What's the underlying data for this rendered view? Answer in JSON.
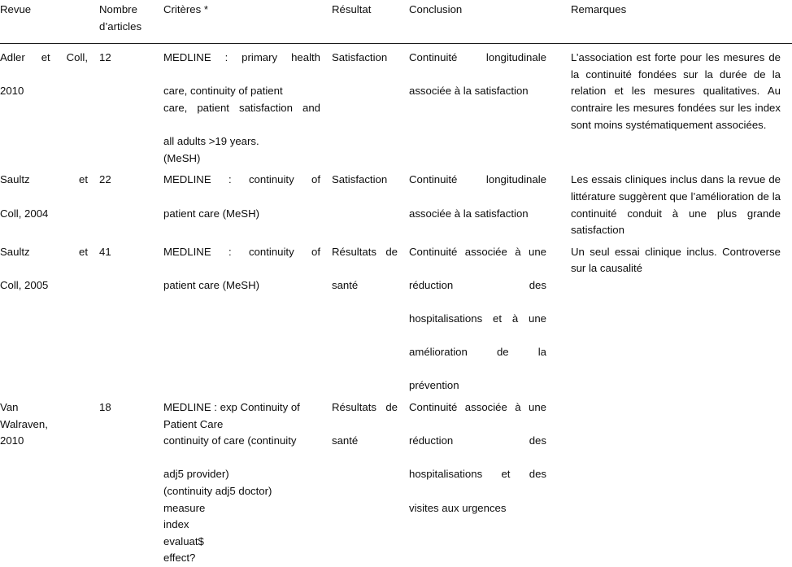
{
  "table": {
    "caption_note": "Critères *",
    "columns": [
      {
        "key": "revue",
        "label": "Revue"
      },
      {
        "key": "nombre",
        "label": "Nombre d’articles",
        "label_line1": "Nombre",
        "label_line2": "d’articles"
      },
      {
        "key": "criteres",
        "label": "Critères *"
      },
      {
        "key": "resultat",
        "label": "Résultat"
      },
      {
        "key": "conclusion",
        "label": "Conclusion"
      },
      {
        "key": "remarques",
        "label": "Remarques"
      }
    ],
    "rows": [
      {
        "revue_line1": "Adler et Coll,",
        "revue_line2": "2010",
        "nombre": "12",
        "criteres_lines": [
          "MEDLINE : primary health",
          "care, continuity of patient",
          "care, patient satisfaction and",
          "all adults >19 years.",
          "(MeSH)"
        ],
        "resultat": "Satisfaction",
        "conclusion_lines": [
          "Continuité longitudinale",
          "associée à la satisfaction"
        ],
        "remarques": "L’association est forte pour les mesures de la continuité fondées sur la durée de la relation et les mesures qualitatives. Au contraire les mesures fondées sur les index sont moins systématiquement associées."
      },
      {
        "revue_line1": "Saultz et",
        "revue_line2": "Coll, 2004",
        "nombre": "22",
        "criteres_lines": [
          "MEDLINE : continuity of",
          "patient care (MeSH)"
        ],
        "resultat": "Satisfaction",
        "conclusion_lines": [
          "Continuité longitudinale",
          "associée à la satisfaction"
        ],
        "remarques": "Les essais cliniques inclus dans la revue de littérature suggèrent que l’amélioration de la continuité conduit à une plus grande satisfaction"
      },
      {
        "revue_line1": "Saultz et",
        "revue_line2": "Coll, 2005",
        "nombre": "41",
        "criteres_lines": [
          "MEDLINE : continuity of",
          "patient care (MeSH)"
        ],
        "resultat_line1": "Résultats de",
        "resultat_line2": "santé",
        "conclusion_lines": [
          "Continuité associée à une",
          "réduction des",
          "hospitalisations et à une",
          "amélioration de la",
          "prévention"
        ],
        "remarques": "Un seul essai clinique inclus. Controverse sur la causalité"
      },
      {
        "revue_line1": "Van",
        "revue_line2": "Walraven,",
        "revue_line3": "2010",
        "nombre": "18",
        "criteres_lines": [
          "MEDLINE : exp Continuity of",
          "Patient Care",
          "continuity of care (continuity",
          "adj5 provider)",
          "(continuity adj5 doctor)",
          "measure",
          "index",
          "evaluat$",
          "effect?"
        ],
        "resultat_line1": "Résultats de",
        "resultat_line2": "santé",
        "conclusion_lines": [
          "Continuité associée à une",
          "réduction des",
          "hospitalisations et des",
          "visites aux urgences"
        ],
        "remarques": ""
      }
    ]
  },
  "style": {
    "text_color": "#0d0d0d",
    "rule_color": "#1a1a1a",
    "background": "#ffffff"
  }
}
